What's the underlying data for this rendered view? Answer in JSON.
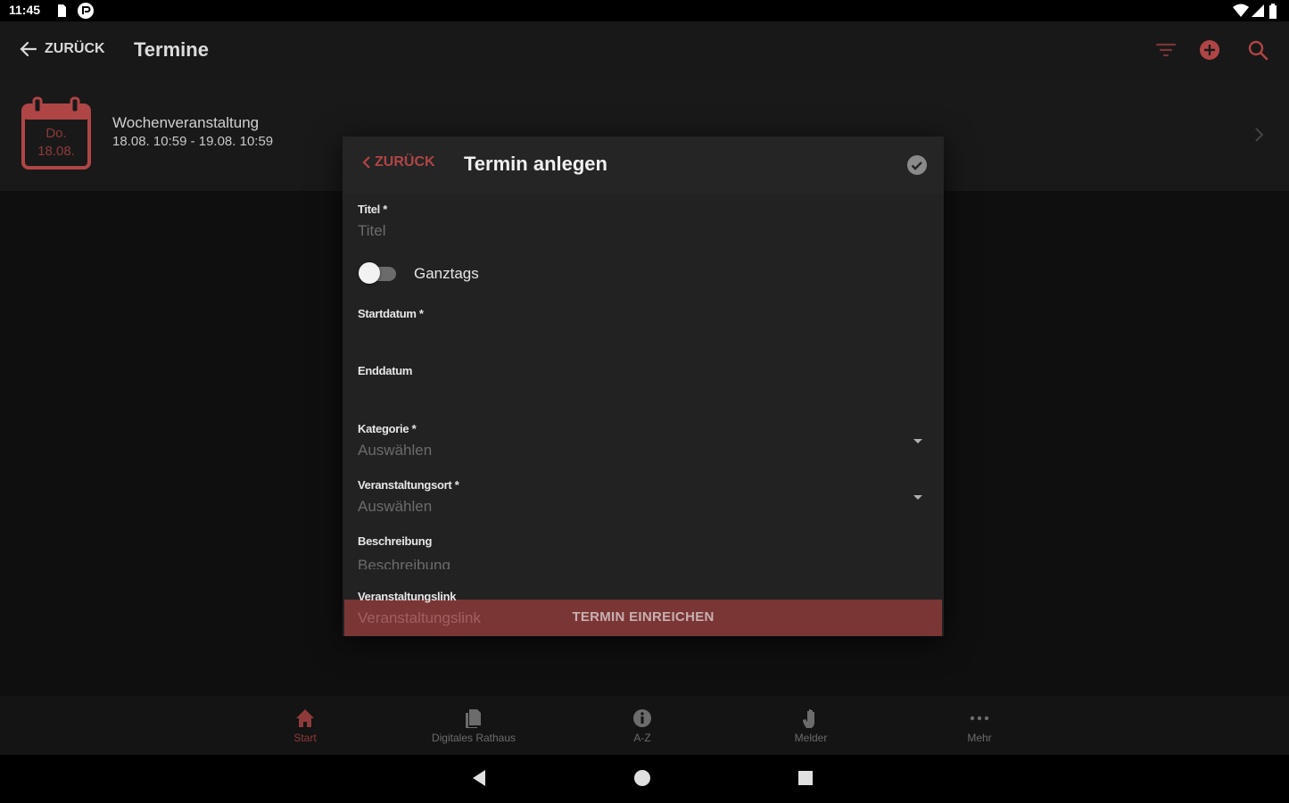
{
  "status_bar": {
    "time": "11:45"
  },
  "header": {
    "back_label": "ZURÜCK",
    "title": "Termine"
  },
  "toolbar_icons": [
    "filter-icon",
    "add-circle-icon",
    "search-icon"
  ],
  "event": {
    "weekday": "Do.",
    "day": "18.08.",
    "title": "Wochenveranstaltung",
    "date_range": "18.08. 10:59 - 19.08. 10:59"
  },
  "dialog": {
    "back_label": "ZURÜCK",
    "title": "Termin anlegen",
    "fields": {
      "titel_label": "Titel *",
      "titel_placeholder": "Titel",
      "ganztags_label": "Ganztags",
      "startdatum_label": "Startdatum *",
      "enddatum_label": "Enddatum",
      "kategorie_label": "Kategorie *",
      "kategorie_value": "Auswählen",
      "ort_label": "Veranstaltungsort *",
      "ort_value": "Auswählen",
      "beschreibung_label": "Beschreibung",
      "beschreibung_placeholder": "Beschreibung",
      "link_label": "Veranstaltungslink",
      "link_placeholder": "Veranstaltungslink"
    },
    "submit_label": "TERMIN EINREICHEN"
  },
  "bottom_nav": {
    "items": [
      {
        "label": "Start",
        "icon": "home-icon",
        "active": true
      },
      {
        "label": "Digitales Rathaus",
        "icon": "documents-icon",
        "active": false
      },
      {
        "label": "A-Z",
        "icon": "info-icon",
        "active": false
      },
      {
        "label": "Melder",
        "icon": "hand-icon",
        "active": false
      },
      {
        "label": "Mehr",
        "icon": "more-icon",
        "active": false
      }
    ]
  },
  "colors": {
    "accent": "#b04545",
    "submit_bg": "#7a3535",
    "background": "#0f0f0f"
  }
}
